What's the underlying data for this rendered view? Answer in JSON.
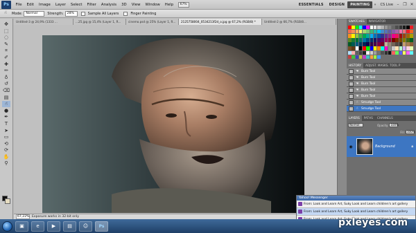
{
  "app": {
    "logo": "Ps"
  },
  "menubar": {
    "items": [
      "File",
      "Edit",
      "Image",
      "Layer",
      "Select",
      "Filter",
      "Analysis",
      "3D",
      "View",
      "Window",
      "Help"
    ],
    "zoom_mini": "67%"
  },
  "workspace": {
    "essentials": "ESSENTIALS",
    "design": "DESIGN",
    "painting": "PAINTING",
    "more": "»",
    "cslive": "CS Live"
  },
  "window_controls": {
    "minimize": "–",
    "restore": "❐",
    "close": "✕"
  },
  "options": {
    "mode_label": "Mode:",
    "mode_value": "Normal",
    "strength_label": "Strength:",
    "strength_value": "28%",
    "sample_all_layers": "Sample All Layers",
    "finger_painting": "Finger Painting"
  },
  "tabs": [
    {
      "label": "Untitled-3 @ 24,9% (1333 ..."
    },
    {
      "label": "...25.jpg @ 15,4% (Layer 1, R..."
    },
    {
      "label": "cinemo.psd @ 25% (Layer 1, R..."
    },
    {
      "label": "2125758004_0534213f2d_o.jpg @ 67,2% (RGB/8) *"
    },
    {
      "label": "Untitled-2 @ 66,7% (RGB/8..."
    }
  ],
  "tools": [
    "move-icon",
    "marquee-icon",
    "lasso-icon",
    "quick-select-icon",
    "crop-icon",
    "eyedropper-icon",
    "healing-icon",
    "brush-icon",
    "clone-stamp-icon",
    "history-brush-icon",
    "eraser-icon",
    "gradient-icon",
    "smudge-icon",
    "dodge-icon",
    "pen-icon",
    "type-icon",
    "path-select-icon",
    "shape-icon",
    "3d-rotate-icon",
    "3d-orbit-icon",
    "hand-icon",
    "zoom-icon"
  ],
  "tool_glyphs": [
    "✥",
    "⬚",
    "◌",
    "✎",
    "⌗",
    "✐",
    "✚",
    "✏",
    "♁",
    "↺",
    "⌫",
    "▤",
    "☝",
    "●",
    "✒",
    "T",
    "➤",
    "▭",
    "⟲",
    "⟳",
    "✋",
    "⚲"
  ],
  "status": {
    "zoom": "67,22%",
    "text": "Exposure works in 32-bit only"
  },
  "panels": {
    "swatches_tabs": [
      "SWATCHES",
      "NAVIGATOR"
    ],
    "history_tabs": [
      "HISTORY",
      "ADJUST. MASKS. TOOL P"
    ],
    "history_items": [
      {
        "label": "Burn Tool",
        "icon": "burn-icon",
        "glyph": "☚"
      },
      {
        "label": "Burn Tool",
        "icon": "burn-icon",
        "glyph": "☚"
      },
      {
        "label": "Burn Tool",
        "icon": "burn-icon",
        "glyph": "☚"
      },
      {
        "label": "Burn Tool",
        "icon": "burn-icon",
        "glyph": "☚"
      },
      {
        "label": "Burn Tool",
        "icon": "burn-icon",
        "glyph": "☚"
      },
      {
        "label": "Smudge Tool",
        "icon": "smudge-icon",
        "glyph": "☝"
      },
      {
        "label": "Smudge Tool",
        "icon": "smudge-icon",
        "glyph": "☝"
      }
    ],
    "layers_tabs": [
      "LAYERS",
      "PATHS",
      "CHANNELS"
    ],
    "blend": "Normal",
    "opacity_label": "Opacity:",
    "opacity_value": "100%",
    "fill_label": "Fill:",
    "fill_value": "100%",
    "layer_name": "Background"
  },
  "swatch_colors": [
    "#ff0000",
    "#ffff00",
    "#00ff00",
    "#00ffff",
    "#0000ff",
    "#ff00ff",
    "#ffffff",
    "#e6e6e6",
    "#cccccc",
    "#b3b3b3",
    "#999999",
    "#808080",
    "#666666",
    "#4d4d4d",
    "#333333",
    "#1a1a1a",
    "#000000",
    "#ed1c24",
    "#f26c4f",
    "#f68e56",
    "#fbaf5d",
    "#fff568",
    "#acd373",
    "#7cc576",
    "#3bb878",
    "#1abbb4",
    "#00bff3",
    "#438ccb",
    "#5574b9",
    "#605ca8",
    "#855fa8",
    "#a763a8",
    "#f06eaa",
    "#f26d7d",
    "#ed1c24",
    "#f26522",
    "#f7941d",
    "#fff200",
    "#8dc73f",
    "#39b54a",
    "#00a651",
    "#00a99d",
    "#00aeef",
    "#0072bc",
    "#0054a6",
    "#2e3192",
    "#662d91",
    "#92278f",
    "#ec008c",
    "#ed145b",
    "#9e0b0f",
    "#a0410d",
    "#a3620a",
    "#aba000",
    "#598527",
    "#1a7b30",
    "#007236",
    "#00746b",
    "#0076a3",
    "#004b80",
    "#003471",
    "#1b1464",
    "#440e62",
    "#630460",
    "#9e005d",
    "#9e0039",
    "#790000",
    "#7b2e00",
    "#7d4900",
    "#827b00",
    "#406618",
    "#005e20",
    "#005826",
    "#005952",
    "#005b7f",
    "#003663",
    "#002157",
    "#0d004c",
    "#32004b",
    "#4b0049",
    "#7b0046",
    "#7a0026",
    "#c7b299",
    "#998675",
    "#736357",
    "#534741",
    "#37302a",
    "#c69c6d",
    "#a67c52",
    "#8c6239",
    "#754c24",
    "#603913",
    "#ffffff",
    "#000000",
    "#ff0000",
    "#00ff00",
    "#0000ff",
    "#ffff00",
    "#ff8a00",
    "#00ffea",
    "#ff00c8",
    "#8c8c8c",
    "#c8c8c8",
    "#ffe0b0",
    "#b0ffd0",
    "#d0b0ff",
    "#ffd0e0",
    "#e0ffb0",
    "#b0e0ff",
    "#ffb0b0",
    "#606060",
    "#404040",
    "#202020",
    "#f0f0f0",
    "#d0d0d0",
    "#a0a0a0",
    "#707070",
    "#505050",
    "#303030",
    "#101010",
    "#ff6060",
    "#60ff60",
    "#6060ff",
    "#ffff60",
    "#ff60ff",
    "#60ffff",
    "#c04040",
    "#40c040",
    "#4040c0",
    "#c0c040",
    "#c040c0",
    "#40c0c0",
    "#ff9f40",
    "#9fff40",
    "#409fff"
  ],
  "messenger": {
    "title": "Yahoo! Messenger",
    "items": [
      "From: Look and Learn Art, Suky Look and Learn children's art gallery",
      "From: Look and Learn Art, Suky Look and Learn children's art gallery",
      "From: Look and Learn Art, Suky Look and Learn children's art gallery"
    ]
  },
  "taskbar": {
    "apps": [
      {
        "name": "taskbar-explorer-icon",
        "glyph": "▣"
      },
      {
        "name": "taskbar-ie-icon",
        "glyph": "e"
      },
      {
        "name": "taskbar-media-icon",
        "glyph": "▶"
      },
      {
        "name": "taskbar-folder-icon",
        "glyph": "▤"
      },
      {
        "name": "taskbar-messenger-icon",
        "glyph": "☺"
      },
      {
        "name": "taskbar-photoshop-icon",
        "glyph": "Ps"
      }
    ]
  },
  "watermark": "pxleyes.com"
}
